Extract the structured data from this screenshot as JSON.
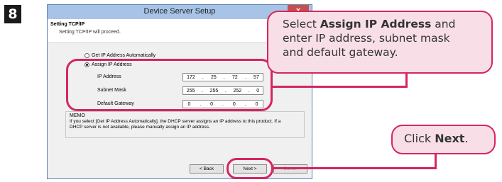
{
  "step_number": "8",
  "window": {
    "title": "Device Server Setup",
    "close_symbol": "×",
    "header_title": "Setting TCP/IP",
    "header_subtitle": "Setting TCP/IP will proceed."
  },
  "options": {
    "auto": "Get IP Address Automatically",
    "assign": "Assign IP Address"
  },
  "fields": {
    "ip": {
      "label": "IP Address",
      "octets": [
        "172",
        "25",
        "72",
        "57"
      ]
    },
    "subnet": {
      "label": "Subnet Mask",
      "octets": [
        "255",
        "255",
        "252",
        "0"
      ]
    },
    "gateway": {
      "label": "Default Gateway",
      "octets": [
        "0",
        "0",
        "0",
        "0"
      ]
    }
  },
  "memo": {
    "title": "MEMO",
    "text": "If you select [Get IP Address Automatically], the DHCP server assigns an IP address to this product. If a DHCP server is not available, please manually assign an IP address."
  },
  "buttons": {
    "back": "< Back",
    "next": "Next >",
    "cancel": "Cancel"
  },
  "callouts": {
    "assign_pre": "Select ",
    "assign_bold": "Assign IP Address",
    "assign_rest1": " and",
    "assign_line2": "enter IP address, subnet mask",
    "assign_line3": "and default gateway.",
    "next_pre": "Click ",
    "next_bold": "Next",
    "next_post": "."
  },
  "colors": {
    "highlight": "#d6265f",
    "callout_fill": "#f8dfe7",
    "titlebar": "#a7c4e6"
  }
}
